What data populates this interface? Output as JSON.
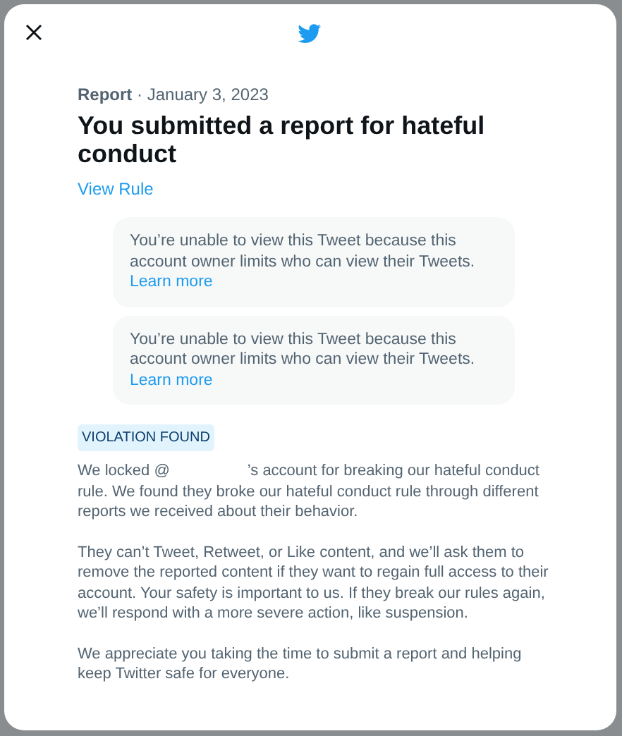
{
  "report": {
    "label": "Report",
    "separator": "·",
    "date": "January 3, 2023",
    "title": "You submitted a report for hateful conduct",
    "rule_link": "View Rule"
  },
  "tweets": [
    {
      "text": "You’re unable to view this Tweet because this account owner limits who can view their Tweets.",
      "link": "Learn more"
    },
    {
      "text": "You’re unable to view this Tweet because this account owner limits who can view their Tweets.",
      "link": "Learn more"
    }
  ],
  "badge": "VIOLATION FOUND",
  "paragraphs": [
    {
      "before": "We locked @",
      "after": "’s account for breaking our hateful conduct rule. We found they broke our hateful conduct rule through different reports we received about their behavior."
    },
    {
      "text": "They can’t Tweet, Retweet, or Like content, and we’ll ask them to remove the reported content if they want to regain full access to their account. Your safety is important to us. If they break our rules again, we’ll respond with a more severe action, like suspension."
    },
    {
      "text": "We appreciate you taking the time to submit a report and helping keep Twitter safe for everyone."
    }
  ]
}
